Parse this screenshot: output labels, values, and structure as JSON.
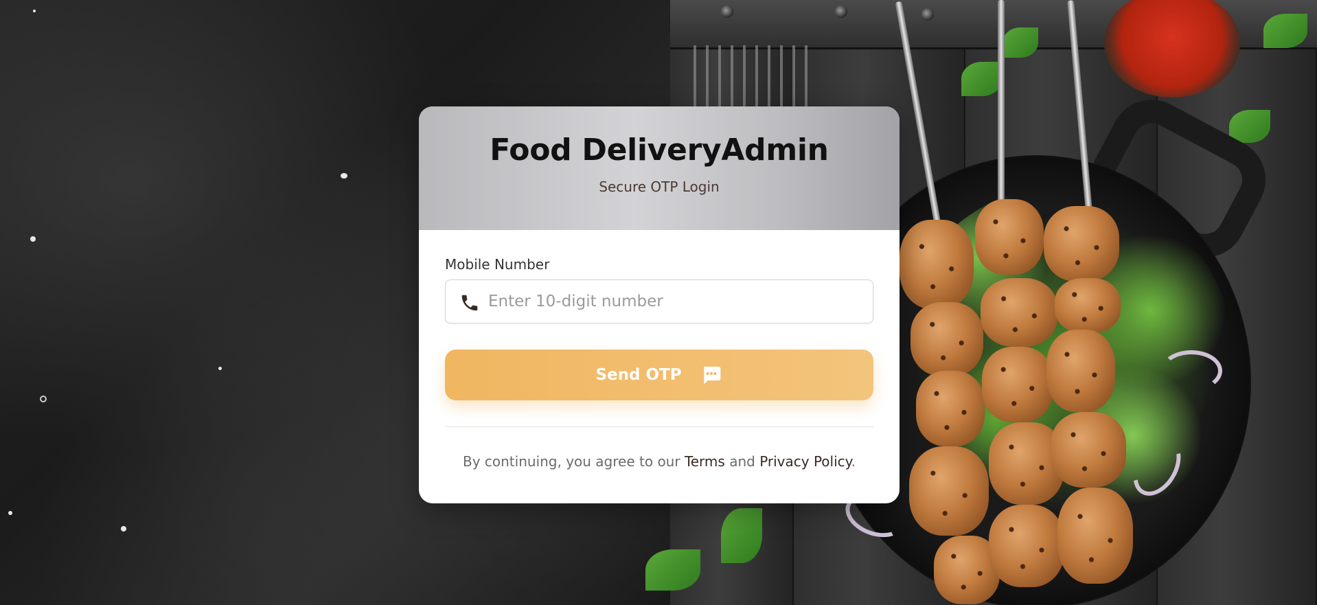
{
  "app": {
    "title": "Food DeliveryAdmin",
    "subtitle": "Secure OTP Login"
  },
  "form": {
    "mobile_label": "Mobile Number",
    "mobile_placeholder": "Enter 10-digit number",
    "mobile_value": "",
    "phone_icon": "phone-icon",
    "send_button_label": "Send OTP",
    "send_button_icon": "chat-bubble-icon"
  },
  "footer": {
    "prefix": "By continuing, you agree to our ",
    "terms_link": "Terms",
    "and": " and ",
    "privacy_link": "Privacy Policy",
    "suffix": "."
  },
  "colors": {
    "accent": "#f0b660",
    "header_gradient_start": "#b9b9bc",
    "title": "#111111",
    "link": "#3a2a22"
  }
}
